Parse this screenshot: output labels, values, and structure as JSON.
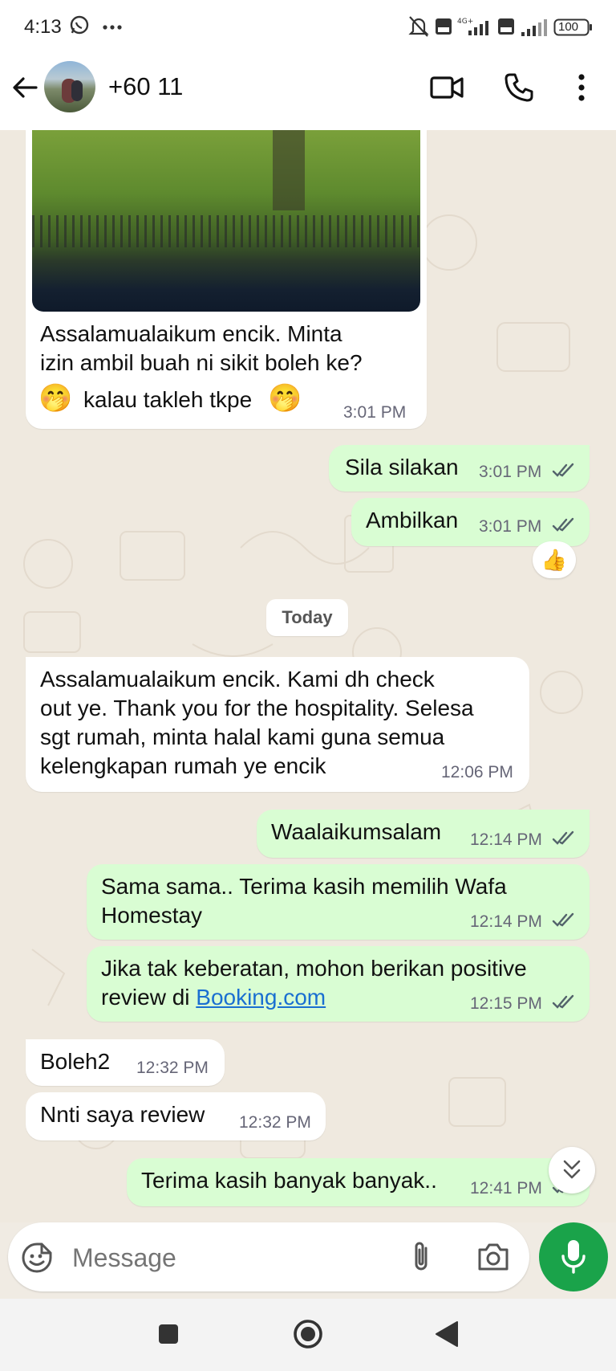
{
  "status_bar": {
    "time": "4:13",
    "battery": "100"
  },
  "header": {
    "contact_name": "+60 11"
  },
  "messages": [
    {
      "text": "Assalamualaikum encik. Minta\nizin ambil buah ni sikit boleh ke?",
      "text2": "kalau takleh tkpe",
      "time": "3:01 PM"
    },
    {
      "text": "Sila silakan",
      "time": "3:01 PM"
    },
    {
      "text": "Ambilkan",
      "time": "3:01 PM"
    },
    {
      "text": "Assalamualaikum encik. Kami dh check\nout ye. Thank you for the hospitality. Selesa\nsgt rumah, minta halal kami guna semua\nkelengkapan rumah ye encik",
      "time": "12:06 PM"
    },
    {
      "text": "Waalaikumsalam",
      "time": "12:14 PM"
    },
    {
      "text": "Sama sama.. Terima kasih memilih Wafa\nHomestay",
      "time": "12:14 PM"
    },
    {
      "text": "Jika tak keberatan, mohon berikan positive\nreview di ",
      "link": "Booking.com",
      "time": "12:15 PM"
    },
    {
      "text": "Boleh2",
      "time": "12:32 PM"
    },
    {
      "text": "Nnti saya review",
      "time": "12:32 PM"
    },
    {
      "text": "Terima kasih banyak banyak..",
      "time": "12:41 PM"
    }
  ],
  "reaction": {
    "emoji": "👍"
  },
  "date_divider": {
    "label": "Today"
  },
  "composer": {
    "placeholder": "Message"
  },
  "colors": {
    "incoming": "#ffffff",
    "outgoing": "#d9fdd3",
    "accent": "#1aa34a",
    "link": "#1a6fd1",
    "ticks": "#53636b"
  }
}
